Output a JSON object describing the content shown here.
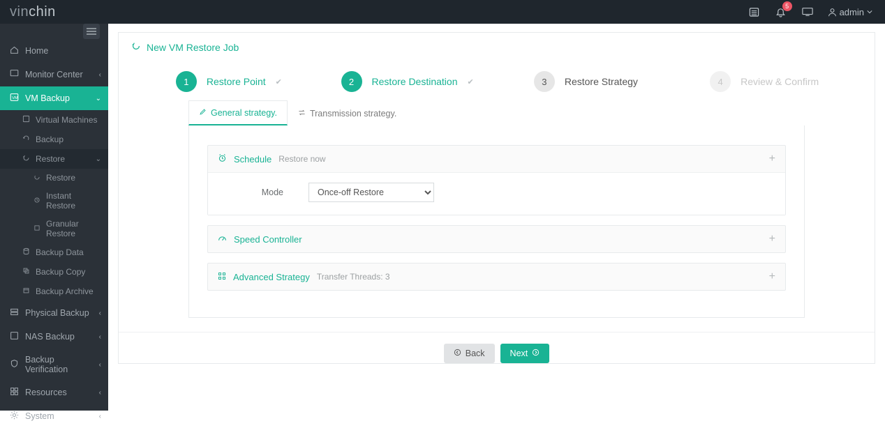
{
  "brand": {
    "prefix": "vin",
    "suffix": "chin"
  },
  "topbar": {
    "user_label": "admin",
    "notification_count": "5"
  },
  "sidebar": {
    "home": "Home",
    "monitor": "Monitor Center",
    "vm_backup": "VM Backup",
    "virtual_machines": "Virtual Machines",
    "backup": "Backup",
    "restore": "Restore",
    "restore_sub": "Restore",
    "instant_restore": "Instant Restore",
    "granular_restore": "Granular Restore",
    "backup_data": "Backup Data",
    "backup_copy": "Backup Copy",
    "backup_archive": "Backup Archive",
    "physical_backup": "Physical Backup",
    "nas_backup": "NAS Backup",
    "backup_verification": "Backup Verification",
    "resources": "Resources",
    "system": "System"
  },
  "page_title": "New VM Restore Job",
  "wizard": {
    "step1": {
      "num": "1",
      "label": "Restore Point"
    },
    "step2": {
      "num": "2",
      "label": "Restore Destination"
    },
    "step3": {
      "num": "3",
      "label": "Restore Strategy"
    },
    "step4": {
      "num": "4",
      "label": "Review & Confirm"
    }
  },
  "tabs": {
    "general": "General strategy.",
    "transmission": "Transmission strategy."
  },
  "sections": {
    "schedule": {
      "title": "Schedule",
      "hint": "Restore now"
    },
    "mode_label": "Mode",
    "mode_value": "Once-off Restore",
    "speed": {
      "title": "Speed Controller"
    },
    "advanced": {
      "title": "Advanced Strategy",
      "hint": "Transfer Threads: 3"
    }
  },
  "buttons": {
    "back": "Back",
    "next": "Next"
  }
}
